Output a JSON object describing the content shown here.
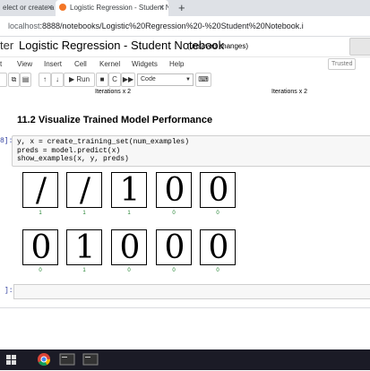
{
  "browser": {
    "tabs": [
      {
        "label": "elect or create a n",
        "active": false
      },
      {
        "label": "Logistic Regression - Student N",
        "active": true
      }
    ],
    "url_host": "localhost",
    "url_path": ":8888/notebooks/Logistic%20Regression%20-%20Student%20Notebook.ipynb"
  },
  "jupyter": {
    "logo_fragment": "ter",
    "title": "Logistic Regression - Student Notebook",
    "status": "(unsaved changes)",
    "trusted_label": "Trusted",
    "menu": [
      "t",
      "View",
      "Insert",
      "Cell",
      "Kernel",
      "Widgets",
      "Help"
    ],
    "toolbar": {
      "run_label": "Run",
      "cell_type": "Code"
    }
  },
  "notebook": {
    "axis_labels": [
      "Iterations x 2",
      "Iterations x 2"
    ],
    "heading": "11.2 Visualize Trained Model Performance",
    "prompt": "8]:",
    "code_lines": [
      "y, x = create_training_set(num_examples)",
      "preds = model.predict(x)",
      "show_examples(x, y, preds)"
    ],
    "digits_row1": [
      {
        "glyph": "/",
        "pred": "1"
      },
      {
        "glyph": "/",
        "pred": "1"
      },
      {
        "glyph": "1",
        "pred": "1"
      },
      {
        "glyph": "0",
        "pred": "0"
      },
      {
        "glyph": "0",
        "pred": "0"
      }
    ],
    "digits_row2": [
      {
        "glyph": "0",
        "pred": "0"
      },
      {
        "glyph": "1",
        "pred": "1"
      },
      {
        "glyph": "0",
        "pred": "0"
      },
      {
        "glyph": "0",
        "pred": "0"
      },
      {
        "glyph": "0",
        "pred": "0"
      }
    ],
    "empty_prompt": "]:"
  },
  "colors": {
    "prediction": "#1d7f2c",
    "prompt": "#303f9f",
    "taskbar": "#1b1b26"
  },
  "taskbar_icons": [
    "windows-icon",
    "search-icon",
    "task-view-icon",
    "file-explorer-icon",
    "chrome-icon",
    "terminal-icon",
    "terminal-icon"
  ]
}
